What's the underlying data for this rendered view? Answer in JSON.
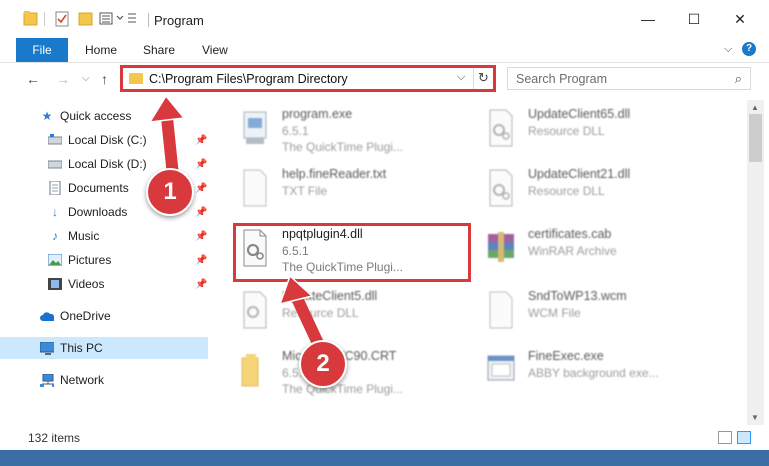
{
  "window": {
    "title": "Program",
    "minimize": "—",
    "maximize": "☐",
    "close": "✕"
  },
  "ribbon": {
    "file": "File",
    "home": "Home",
    "share": "Share",
    "view": "View",
    "expand": "⌵",
    "help": "?"
  },
  "nav": {
    "back": "←",
    "forward": "→",
    "recent": "⌵",
    "up": "↑",
    "address": "C:\\Program Files\\Program Directory",
    "dropdown": "⌵",
    "refresh": "↻",
    "search_placeholder": "Search Program",
    "search_icon": "⌕"
  },
  "sidebar": {
    "items": [
      {
        "label": "Quick access",
        "icon": "star-icon"
      },
      {
        "label": "Local Disk (C:)",
        "icon": "drive-icon"
      },
      {
        "label": "Local Disk (D:)",
        "icon": "drive-icon"
      },
      {
        "label": "Documents",
        "icon": "document-icon"
      },
      {
        "label": "Downloads",
        "icon": "download-icon"
      },
      {
        "label": "Music",
        "icon": "music-icon"
      },
      {
        "label": "Pictures",
        "icon": "pictures-icon"
      },
      {
        "label": "Videos",
        "icon": "videos-icon"
      },
      {
        "label": "OneDrive",
        "icon": "cloud-icon"
      },
      {
        "label": "This PC",
        "icon": "computer-icon"
      },
      {
        "label": "Network",
        "icon": "network-icon"
      }
    ]
  },
  "files": [
    {
      "name": "program.exe",
      "line1": "6.5.1",
      "line2": "The QuickTime Plugi...",
      "icon": "exe-icon"
    },
    {
      "name": "UpdateClient65.dll",
      "line1": "Resource DLL",
      "line2": "",
      "icon": "dll-icon"
    },
    {
      "name": "help.fineReader.txt",
      "line1": "TXT File",
      "line2": "",
      "icon": "txt-icon"
    },
    {
      "name": "UpdateClient21.dll",
      "line1": "Resource DLL",
      "line2": "",
      "icon": "dll-icon"
    },
    {
      "name": "npqtplugin4.dll",
      "line1": "6.5.1",
      "line2": "The QuickTime Plugi...",
      "icon": "dll-icon"
    },
    {
      "name": "certificates.cab",
      "line1": "WinRAR Archive",
      "line2": "",
      "icon": "archive-icon"
    },
    {
      "name": "UpdateClient5.dll",
      "line1": "Resource DLL",
      "line2": "",
      "icon": "dll-icon"
    },
    {
      "name": "SndToWP13.wcm",
      "line1": "WCM File",
      "line2": "",
      "icon": "file-icon"
    },
    {
      "name": "Microsoft.VC90.CRT",
      "line1": "6.5.1",
      "line2": "The QuickTime Plugi...",
      "icon": "folder-icon"
    },
    {
      "name": "FineExec.exe",
      "line1": "ABBY background exe...",
      "line2": "",
      "icon": "exe-icon"
    }
  ],
  "status": {
    "count": "132 items"
  },
  "callouts": {
    "one": "1",
    "two": "2"
  },
  "colors": {
    "accent": "#1979ca",
    "highlight": "#d8393d",
    "selection": "#cce8ff"
  }
}
